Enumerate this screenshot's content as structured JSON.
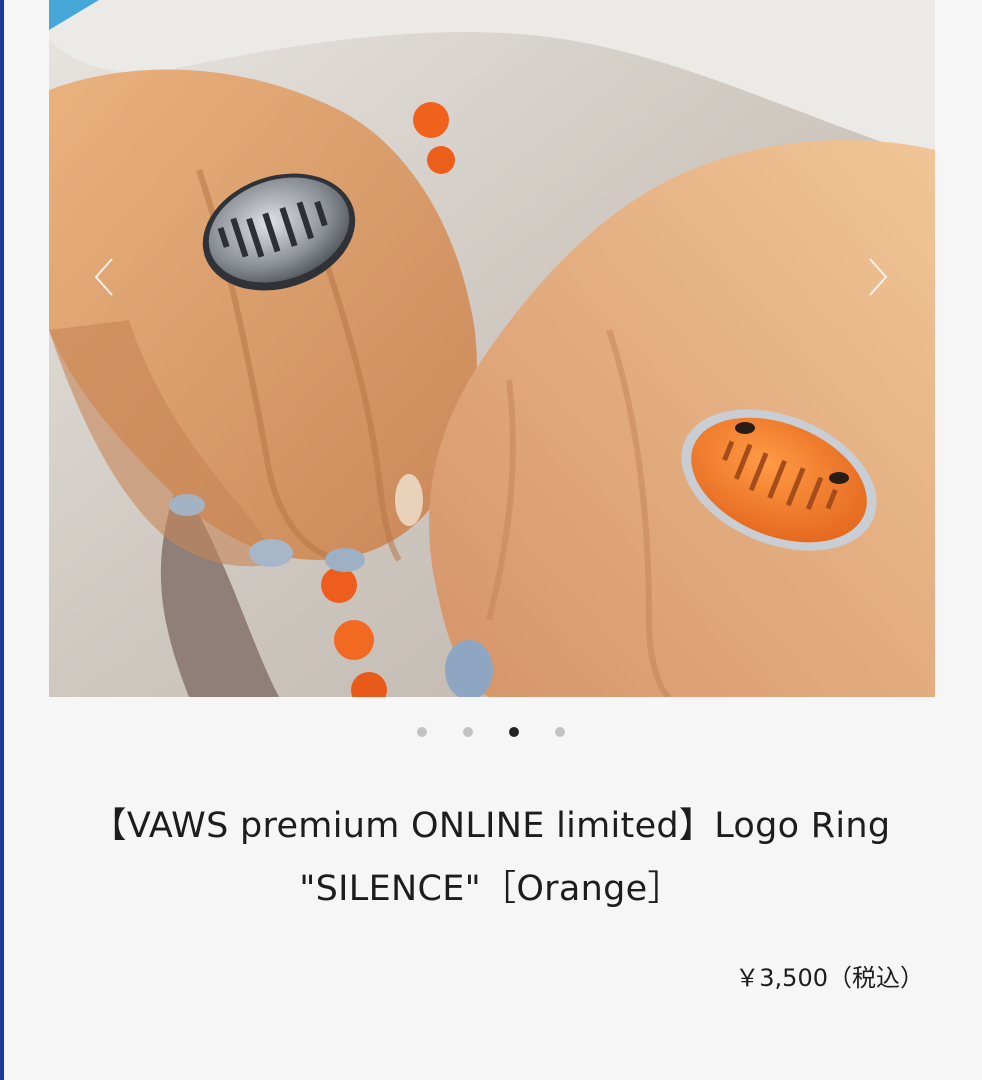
{
  "product": {
    "title": "【VAWS premium ONLINE limited】Logo Ring \"SILENCE\"［Orange］",
    "price": "￥3,500（税込）"
  },
  "carousel": {
    "total_slides": 4,
    "active_index": 2,
    "prev_icon": "chevron-left-icon",
    "next_icon": "chevron-right-icon"
  },
  "colors": {
    "background": "#f6f6f6",
    "dot_inactive": "#c3c3c3",
    "dot_active": "#222222",
    "left_edge": "#1d3a9a",
    "ring_enamel": "#f07a2a"
  }
}
